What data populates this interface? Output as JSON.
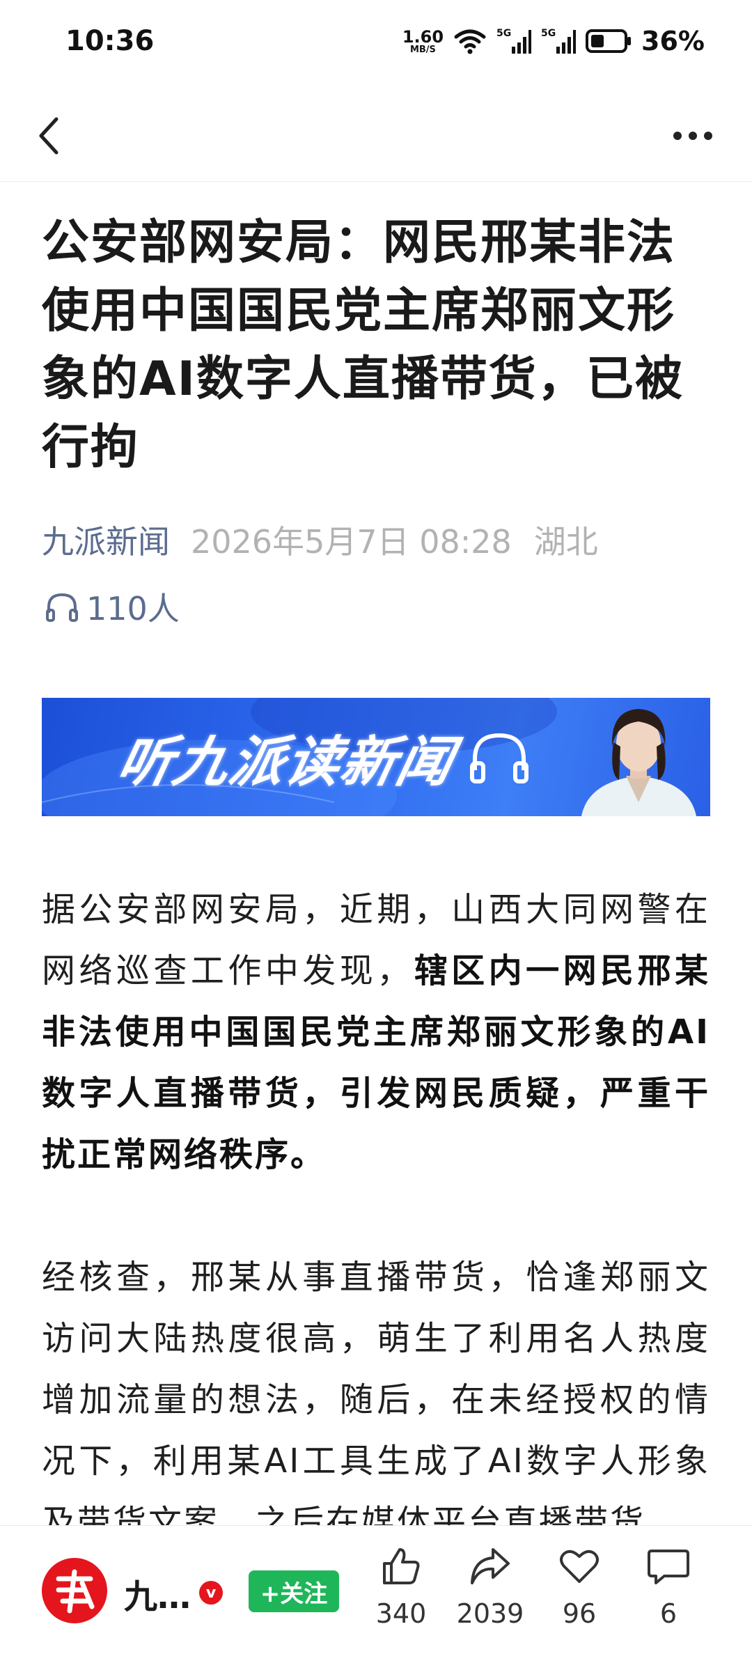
{
  "status_bar": {
    "time": "10:36",
    "net_speed_value": "1.60",
    "net_speed_unit": "MB/S",
    "signal_1": "5G",
    "signal_2": "5G",
    "battery": "36%"
  },
  "nav": {
    "back_icon": "chevron-left-icon",
    "more_icon": "more-dots-icon"
  },
  "article": {
    "title": "公安部网安局：网民邢某非法使用中国国民党主席郑丽文形象的AI数字人直播带货，已被行拘",
    "source": "九派新闻",
    "date": "2026年5月7日 08:28",
    "region": "湖北",
    "listeners": "110人",
    "banner_text": "听九派读新闻",
    "paragraphs": [
      {
        "normal": "据公安部网安局，近期，山西大同网警在网络巡查工作中发现，",
        "bold": "辖区内一网民邢某非法使用中国国民党主席郑丽文形象的AI数字人直播带货，引发网民质疑，严重干扰正常网络秩序。"
      },
      {
        "normal": "经核查，邢某从事直播带货，恰逢郑丽文访问大陆热度很高，萌生了利用名人热度增加流量的想法，随后，在未经授权的情况下，利用某AI工具生成了AI数字人形象及带货文案，之后在媒体平台直播带货。",
        "bold": ""
      }
    ]
  },
  "bottom_bar": {
    "author": "九…",
    "verified": "v",
    "follow": "+关注",
    "like_count": "340",
    "share_count": "2039",
    "favorite_count": "96",
    "comment_count": "6"
  },
  "colors": {
    "accent_blue": "#5b6c8e",
    "follow_green": "#1fb65a",
    "brand_red": "#e5151d"
  }
}
